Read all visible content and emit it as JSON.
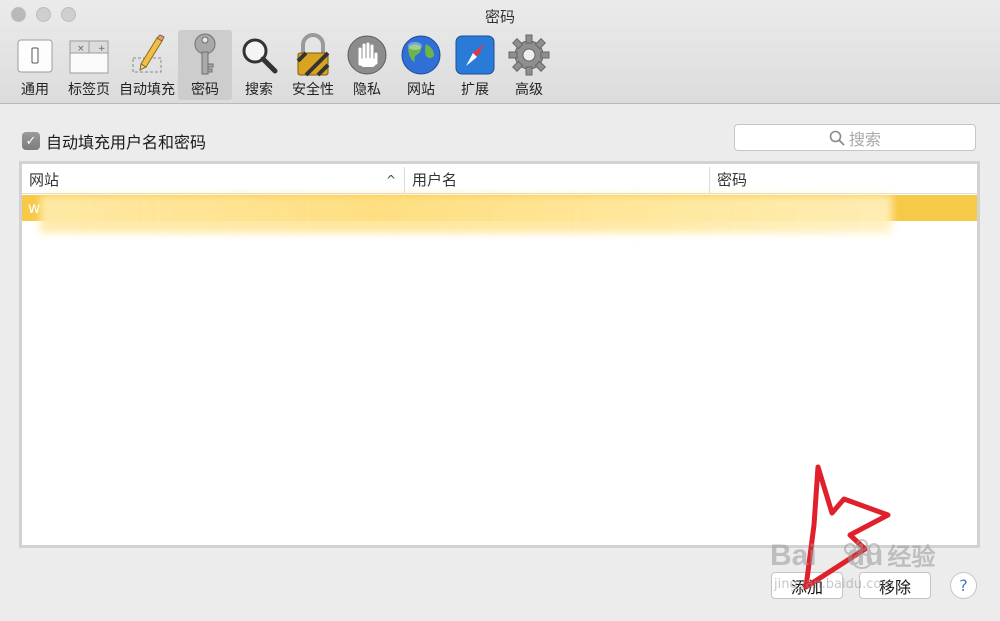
{
  "window": {
    "title": "密码"
  },
  "toolbar": {
    "items": [
      {
        "label": "通用",
        "icon": "general-switch-icon"
      },
      {
        "label": "标签页",
        "icon": "tabs-icon"
      },
      {
        "label": "自动填充",
        "icon": "pencil-icon"
      },
      {
        "label": "密码",
        "icon": "key-icon",
        "active": true
      },
      {
        "label": "搜索",
        "icon": "magnifier-icon"
      },
      {
        "label": "安全性",
        "icon": "padlock-icon"
      },
      {
        "label": "隐私",
        "icon": "hand-icon"
      },
      {
        "label": "网站",
        "icon": "globe-icon"
      },
      {
        "label": "扩展",
        "icon": "compass-icon"
      },
      {
        "label": "高级",
        "icon": "gear-icon"
      }
    ]
  },
  "main": {
    "autofill_label": "自动填充用户名和密码",
    "autofill_checked": true,
    "search_placeholder": "搜索",
    "table": {
      "columns": [
        "网站",
        "用户名",
        "密码"
      ],
      "sort_indicator": "^",
      "rows": [
        {
          "site": "w",
          "user": "",
          "password": ""
        }
      ],
      "selected_row_color": "#f7c948"
    }
  },
  "footer": {
    "add_label": "添加",
    "remove_label": "移除",
    "help_label": "?"
  },
  "watermark": {
    "brand": "Bai",
    "brand2": "du",
    "suffix": "经验",
    "url": "jingyan.baidu.com"
  },
  "colors": {
    "accent_row": "#f7c948",
    "annotation": "#e0202a"
  }
}
